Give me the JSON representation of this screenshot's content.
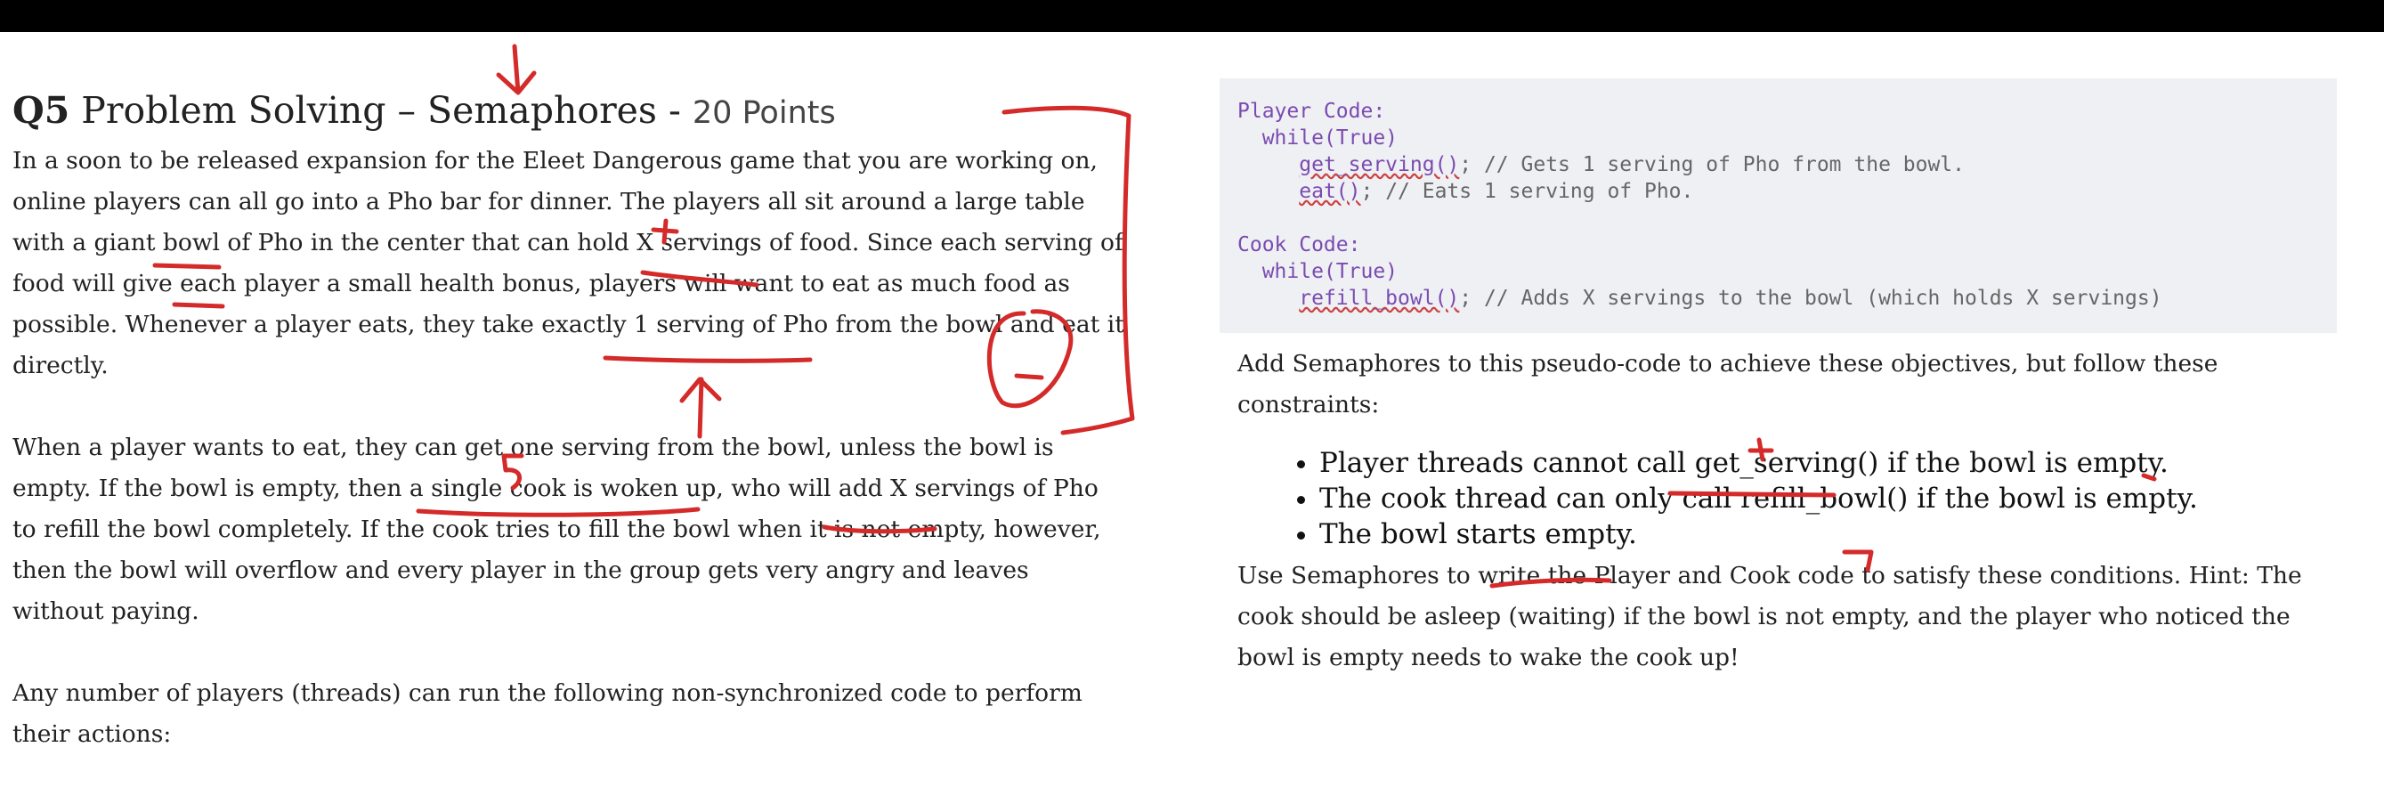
{
  "question": {
    "label": "Q5",
    "title": " Problem Solving – Semaphores - ",
    "points": "20 Points"
  },
  "left_paragraphs": [
    "In a soon to be released expansion for the Eleet Dangerous game that you are working on, online players can all go into a Pho bar for dinner. The players all sit around a large table with a giant bowl of Pho in the center that can hold X servings of food. Since each serving of food will give each player a small health bonus, players will want to eat as much food as possible. Whenever a player eats, they take exactly 1 serving of Pho from the bowl and eat it directly.",
    "When a player wants to eat, they can get one serving from the bowl, unless the bowl is empty. If the bowl is empty, then a single cook is woken up, who will add X servings of Pho to refill the bowl completely. If the cook tries to fill the bowl when it is not empty, however, then the bowl will overflow and every player in the group gets very angry and leaves without paying.",
    "Any number of players (threads) can run the following non-synchronized code to perform their actions:"
  ],
  "code": {
    "player_header": "Player Code:",
    "player_while": "while(True)",
    "player_call1": "get_serving()",
    "player_rest1": "; // Gets 1 serving of Pho from the bowl.",
    "player_call2": "eat()",
    "player_rest2": "; // Eats 1 serving of Pho.",
    "cook_header": "Cook Code:",
    "cook_while": "while(True)",
    "cook_call": "refill_bowl()",
    "cook_rest": "; // Adds X servings to the bowl (which holds X servings)"
  },
  "instructions": "Add Semaphores to this pseudo-code to achieve these objectives, but follow these constraints:",
  "constraints": [
    "Player threads cannot call get_serving() if the bowl is empty.",
    "The cook thread can only call refill_bowl() if the bowl is empty.",
    "The bowl starts empty."
  ],
  "hint": "Use Semaphores to write the Player and Cook code to satisfy these conditions. Hint: The cook should be asleep (waiting) if the bowl is not empty, and the player who noticed the bowl is empty needs to wake the cook up!",
  "colors": {
    "ink": "#d42a2a",
    "code_bg": "#eef0f4",
    "code_keyword": "#7b4bb0",
    "top_bar": "#000000"
  }
}
